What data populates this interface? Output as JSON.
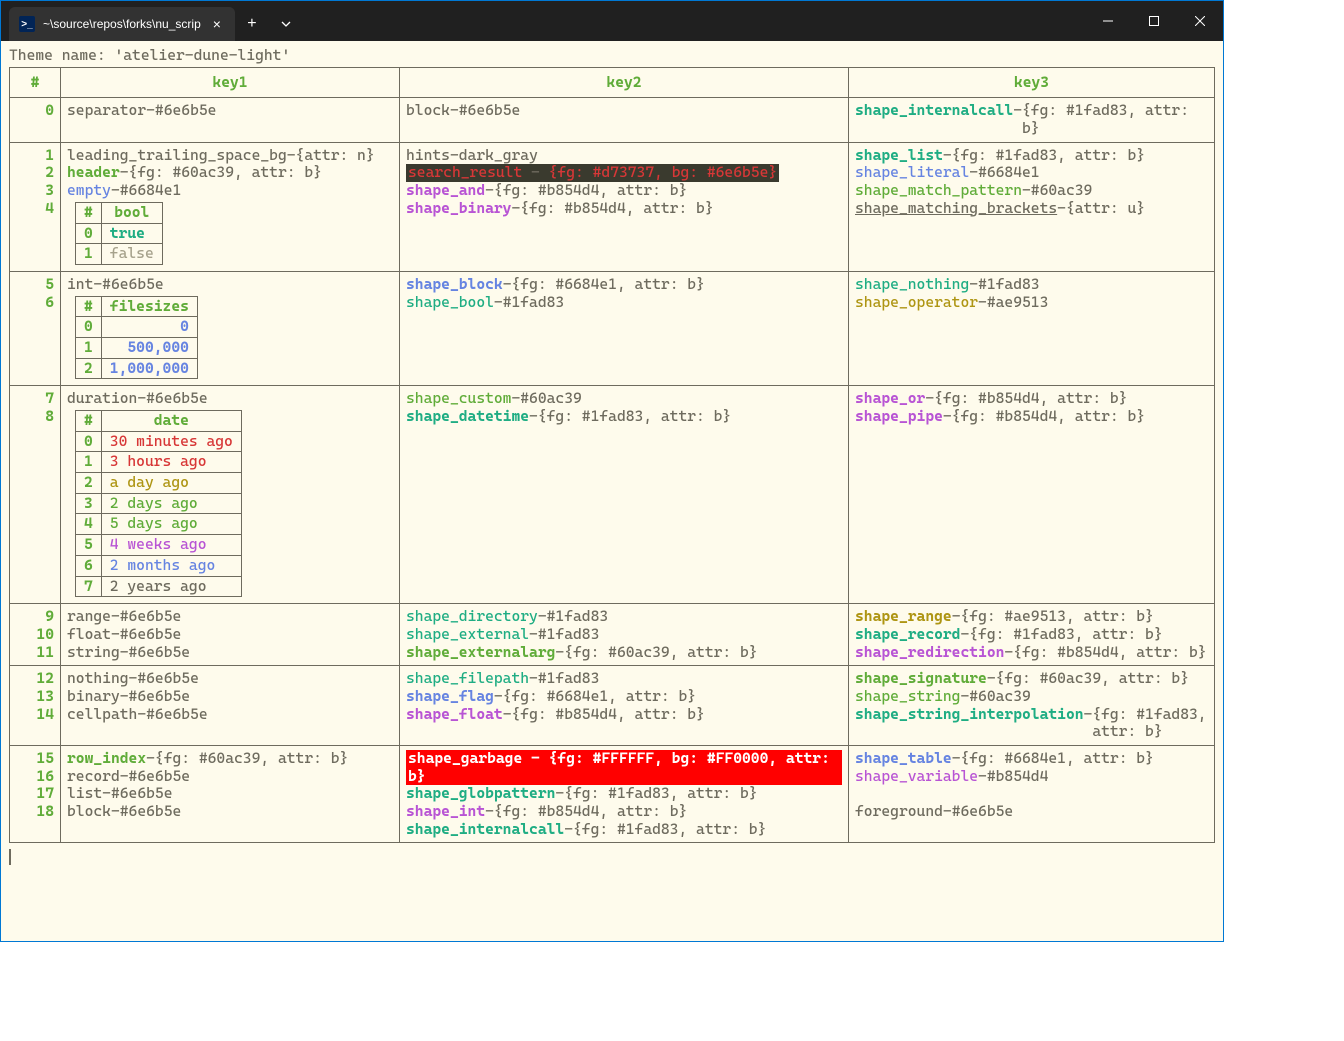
{
  "window": {
    "tab_title": "~\\source\\repos\\forks\\nu_scrip"
  },
  "theme_line": "Theme name: 'atelier-dune-light'",
  "headers": {
    "num": "#",
    "k1": "key1",
    "k2": "key2",
    "k3": "key3"
  },
  "inner_bool": {
    "head_idx": "#",
    "head_val": "bool",
    "rows": [
      {
        "idx": "0",
        "val": "true",
        "cls": "c-bgreen bold"
      },
      {
        "idx": "1",
        "val": "false",
        "cls": "c-dim"
      }
    ]
  },
  "inner_fs": {
    "head_idx": "#",
    "head_val": "filesizes",
    "rows": [
      {
        "idx": "0",
        "val": "0"
      },
      {
        "idx": "1",
        "val": "500,000"
      },
      {
        "idx": "2",
        "val": "1,000,000"
      }
    ]
  },
  "inner_date": {
    "head_idx": "#",
    "head_val": "date",
    "rows": [
      {
        "idx": "0",
        "val": "30 minutes ago",
        "cls": "c-red"
      },
      {
        "idx": "1",
        "val": "3 hours ago",
        "cls": "c-red"
      },
      {
        "idx": "2",
        "val": "a day ago",
        "cls": "c-yellow"
      },
      {
        "idx": "3",
        "val": "2 days ago",
        "cls": "c-green"
      },
      {
        "idx": "4",
        "val": "5 days ago",
        "cls": "c-green"
      },
      {
        "idx": "5",
        "val": "4 weeks ago",
        "cls": "c-purple"
      },
      {
        "idx": "6",
        "val": "2 months ago",
        "cls": "c-blue"
      },
      {
        "idx": "7",
        "val": "2 years ago",
        "cls": "c-fg"
      }
    ]
  },
  "rows": [
    {
      "n": "0",
      "nums": [
        "0"
      ],
      "k1": [
        {
          "key": "separator",
          "kcls": "c-fg",
          "val": "#6e6b5e",
          "vcls": "c-fg"
        }
      ],
      "k2": [
        {
          "key": "block",
          "kcls": "c-fg",
          "val": "#6e6b5e",
          "vcls": "c-fg"
        }
      ],
      "k3": [
        {
          "key": "shape_internalcall",
          "kcls": "c-bgreen bold",
          "val": "{fg: #1fad83, attr: b}",
          "vcls": "c-fg"
        }
      ]
    },
    {
      "n": "1",
      "nums": [
        "1",
        "2",
        "3",
        "4"
      ],
      "k1": [
        {
          "key": "leading_trailing_space_bg",
          "kcls": "c-fg",
          "val": "{attr: n}",
          "vcls": "c-fg"
        },
        {
          "key": "header",
          "kcls": "c-green bold",
          "val": "{fg: #60ac39, attr: b}",
          "vcls": "c-fg"
        },
        {
          "key": "empty",
          "kcls": "c-blue",
          "val": "#6684e1",
          "vcls": "c-fg"
        },
        {
          "special": "bool_table"
        }
      ],
      "k2": [
        {
          "key": "hints",
          "kcls": "c-fg",
          "val": "dark_gray",
          "vcls": "c-fg"
        },
        {
          "special": "search_result"
        },
        {
          "key": "shape_and",
          "kcls": "c-purple bold",
          "val": "{fg: #b854d4, attr: b}",
          "vcls": "c-fg"
        },
        {
          "key": "shape_binary",
          "kcls": "c-purple bold",
          "val": "{fg: #b854d4, attr: b}",
          "vcls": "c-fg"
        }
      ],
      "k3": [
        {
          "key": "shape_list",
          "kcls": "c-bgreen bold",
          "val": "{fg: #1fad83, attr: b}",
          "vcls": "c-fg"
        },
        {
          "key": "shape_literal",
          "kcls": "c-blue",
          "val": "#6684e1",
          "vcls": "c-fg"
        },
        {
          "key": "shape_match_pattern",
          "kcls": "c-green",
          "val": "#60ac39",
          "vcls": "c-fg"
        },
        {
          "key": "shape_matching_brackets",
          "kcls": "c-fg underline",
          "val": "{attr: u}",
          "vcls": "c-fg"
        }
      ]
    },
    {
      "n": "5",
      "nums": [
        "5",
        "6"
      ],
      "k1": [
        {
          "key": "int",
          "kcls": "c-fg",
          "val": "#6e6b5e",
          "vcls": "c-fg"
        },
        {
          "special": "fs_table"
        }
      ],
      "k2": [
        {
          "key": "shape_block",
          "kcls": "c-blue bold",
          "val": "{fg: #6684e1, attr: b}",
          "vcls": "c-fg"
        },
        {
          "key": "shape_bool",
          "kcls": "c-bgreen",
          "val": "#1fad83",
          "vcls": "c-fg"
        }
      ],
      "k3": [
        {
          "key": "shape_nothing",
          "kcls": "c-bgreen",
          "val": "#1fad83",
          "vcls": "c-fg"
        },
        {
          "key": "shape_operator",
          "kcls": "c-yellow",
          "val": "#ae9513",
          "vcls": "c-fg"
        }
      ]
    },
    {
      "n": "7",
      "nums": [
        "7",
        "8"
      ],
      "k1": [
        {
          "key": "duration",
          "kcls": "c-fg",
          "val": "#6e6b5e",
          "vcls": "c-fg"
        },
        {
          "special": "date_table"
        }
      ],
      "k2": [
        {
          "key": "shape_custom",
          "kcls": "c-green",
          "val": "#60ac39",
          "vcls": "c-fg"
        },
        {
          "key": "shape_datetime",
          "kcls": "c-bgreen bold",
          "val": "{fg: #1fad83, attr: b}",
          "vcls": "c-fg"
        }
      ],
      "k3": [
        {
          "key": "shape_or",
          "kcls": "c-purple bold",
          "val": "{fg: #b854d4, attr: b}",
          "vcls": "c-fg"
        },
        {
          "key": "shape_pipe",
          "kcls": "c-purple bold",
          "val": "{fg: #b854d4, attr: b}",
          "vcls": "c-fg"
        }
      ]
    },
    {
      "n": "9",
      "nums": [
        "9",
        "10",
        "11"
      ],
      "k1": [
        {
          "key": "range",
          "kcls": "c-fg",
          "val": "#6e6b5e",
          "vcls": "c-fg"
        },
        {
          "key": "float",
          "kcls": "c-fg",
          "val": "#6e6b5e",
          "vcls": "c-fg"
        },
        {
          "key": "string",
          "kcls": "c-fg",
          "val": "#6e6b5e",
          "vcls": "c-fg"
        }
      ],
      "k2": [
        {
          "key": "shape_directory",
          "kcls": "c-bgreen",
          "val": "#1fad83",
          "vcls": "c-fg"
        },
        {
          "key": "shape_external",
          "kcls": "c-bgreen",
          "val": "#1fad83",
          "vcls": "c-fg"
        },
        {
          "key": "shape_externalarg",
          "kcls": "c-green bold",
          "val": "{fg: #60ac39, attr: b}",
          "vcls": "c-fg"
        }
      ],
      "k3": [
        {
          "key": "shape_range",
          "kcls": "c-yellow bold",
          "val": "{fg: #ae9513, attr: b}",
          "vcls": "c-fg"
        },
        {
          "key": "shape_record",
          "kcls": "c-bgreen bold",
          "val": "{fg: #1fad83, attr: b}",
          "vcls": "c-fg"
        },
        {
          "key": "shape_redirection",
          "kcls": "c-purple bold",
          "val": "{fg: #b854d4, attr: b}",
          "vcls": "c-fg"
        }
      ]
    },
    {
      "n": "12",
      "nums": [
        "12",
        "13",
        "14"
      ],
      "k1": [
        {
          "key": "nothing",
          "kcls": "c-fg",
          "val": "#6e6b5e",
          "vcls": "c-fg"
        },
        {
          "key": "binary",
          "kcls": "c-fg",
          "val": "#6e6b5e",
          "vcls": "c-fg"
        },
        {
          "key": "cellpath",
          "kcls": "c-fg",
          "val": "#6e6b5e",
          "vcls": "c-fg"
        }
      ],
      "k2": [
        {
          "key": "shape_filepath",
          "kcls": "c-bgreen",
          "val": "#1fad83",
          "vcls": "c-fg"
        },
        {
          "key": "shape_flag",
          "kcls": "c-blue bold",
          "val": "{fg: #6684e1, attr: b}",
          "vcls": "c-fg"
        },
        {
          "key": "shape_float",
          "kcls": "c-purple bold",
          "val": "{fg: #b854d4, attr: b}",
          "vcls": "c-fg"
        }
      ],
      "k3": [
        {
          "key": "shape_signature",
          "kcls": "c-green bold",
          "val": "{fg: #60ac39, attr: b}",
          "vcls": "c-fg"
        },
        {
          "key": "shape_string",
          "kcls": "c-green",
          "val": "#60ac39",
          "vcls": "c-fg"
        },
        {
          "key": "shape_string_interpolation",
          "kcls": "c-bgreen bold",
          "val": "{fg: #1fad83, attr: b}",
          "vcls": "c-fg"
        }
      ]
    },
    {
      "n": "15",
      "nums": [
        "15",
        "16",
        "17",
        "18"
      ],
      "k1": [
        {
          "key": "row_index",
          "kcls": "c-green bold",
          "val": "{fg: #60ac39, attr: b}",
          "vcls": "c-fg"
        },
        {
          "key": "record",
          "kcls": "c-fg",
          "val": "#6e6b5e",
          "vcls": "c-fg"
        },
        {
          "key": "list",
          "kcls": "c-fg",
          "val": "#6e6b5e",
          "vcls": "c-fg"
        },
        {
          "key": "block",
          "kcls": "c-fg",
          "val": "#6e6b5e",
          "vcls": "c-fg"
        }
      ],
      "k2": [
        {
          "special": "garbage"
        },
        {
          "key": "shape_globpattern",
          "kcls": "c-bgreen bold",
          "val": "{fg: #1fad83, attr: b}",
          "vcls": "c-fg"
        },
        {
          "key": "shape_int",
          "kcls": "c-purple bold",
          "val": "{fg: #b854d4, attr: b}",
          "vcls": "c-fg"
        },
        {
          "key": "shape_internalcall",
          "kcls": "c-bgreen bold",
          "val": "{fg: #1fad83, attr: b}",
          "vcls": "c-fg"
        }
      ],
      "k3": [
        {
          "key": "shape_table",
          "kcls": "c-blue bold",
          "val": "{fg: #6684e1, attr: b}",
          "vcls": "c-fg"
        },
        {
          "key": "shape_variable",
          "kcls": "c-purple",
          "val": "#b854d4",
          "vcls": "c-fg"
        },
        {
          "blank": true
        },
        {
          "key": "foreground",
          "kcls": "c-fg",
          "val": "#6e6b5e",
          "vcls": "c-fg"
        }
      ]
    }
  ],
  "search_result": {
    "key": "search_result",
    "val": "{fg: #d73737, bg: #6e6b5e}"
  },
  "garbage": {
    "text": "shape_garbage - {fg: #FFFFFF, bg: #FF0000, attr: b}"
  }
}
